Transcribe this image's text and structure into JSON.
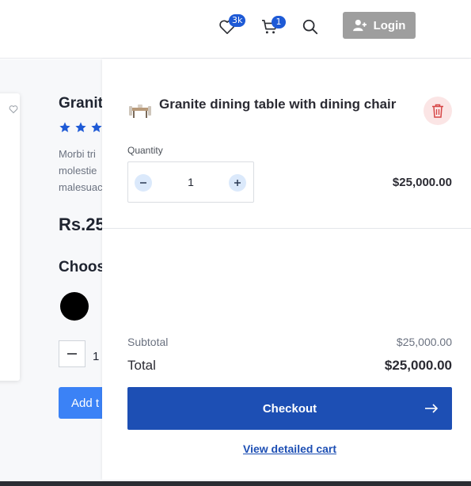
{
  "header": {
    "wishlist_count": "3k",
    "cart_count": "1",
    "login_label": "Login"
  },
  "product": {
    "title": "Granit",
    "rating_stars": 3,
    "desc_lines": [
      "Morbi tri",
      "molestie",
      "malesuac"
    ],
    "price": "Rs.25",
    "choose_label": "Choos",
    "quantity": "1",
    "add_label": "Add t"
  },
  "cart": {
    "item_name": "Granite dining table with dining chair",
    "quantity_label": "Quantity",
    "quantity_value": "1",
    "line_price": "$25,000.00",
    "subtotal_label": "Subtotal",
    "subtotal_value": "$25,000.00",
    "total_label": "Total",
    "total_value": "$25,000.00",
    "checkout_label": "Checkout",
    "view_cart_label": "View detailed cart"
  },
  "icons": {
    "wishlist": "heart-icon",
    "cart": "cart-icon",
    "search": "search-icon",
    "login": "user-plus-icon",
    "delete": "trash-icon",
    "minus": "minus-icon",
    "plus": "plus-icon",
    "checkout": "arrow-right-icon"
  },
  "colors": {
    "accent": "#1d4fb4",
    "badge": "#1e5ad6",
    "star": "#1e5ad6",
    "delete_bg": "#fbe5e5",
    "delete_icon": "#d64545",
    "add_to_cart": "#3b82f6",
    "login_bg": "#9e9e9e"
  }
}
